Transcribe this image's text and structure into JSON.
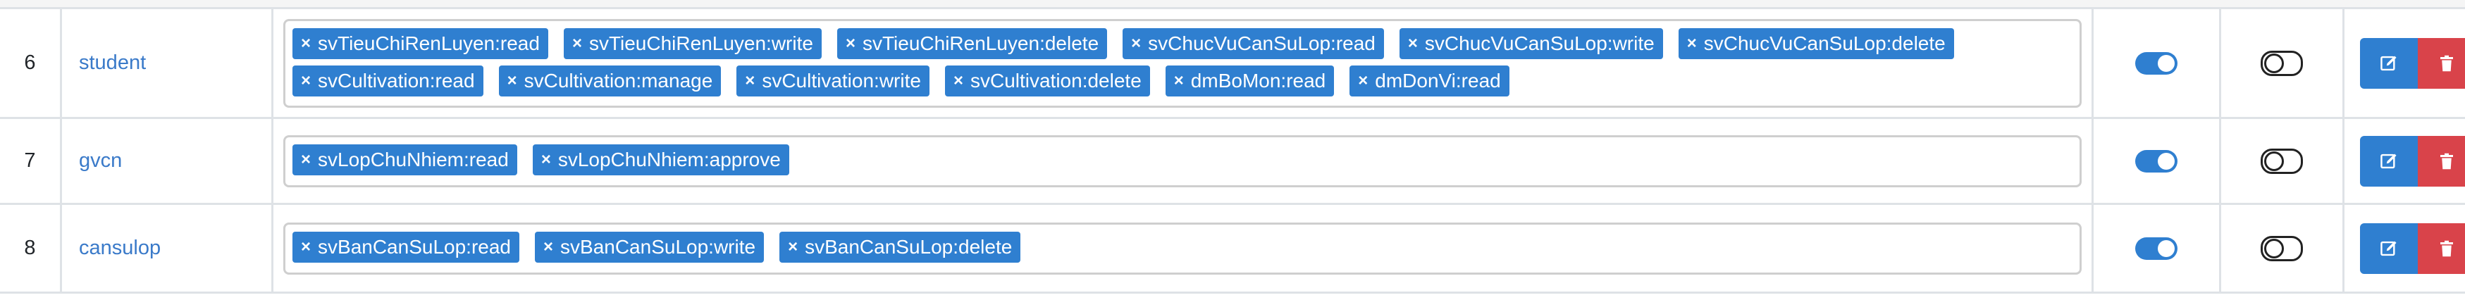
{
  "rows": [
    {
      "index": "6",
      "name": "student",
      "permissions": [
        "svTieuChiRenLuyen:read",
        "svTieuChiRenLuyen:write",
        "svTieuChiRenLuyen:delete",
        "svChucVuCanSuLop:read",
        "svChucVuCanSuLop:write",
        "svChucVuCanSuLop:delete",
        "svCultivation:read",
        "svCultivation:manage",
        "svCultivation:write",
        "svCultivation:delete",
        "dmBoMon:read",
        "dmDonVi:read"
      ],
      "toggle_1": "on",
      "toggle_2": "off"
    },
    {
      "index": "7",
      "name": "gvcn",
      "permissions": [
        "svLopChuNhiem:read",
        "svLopChuNhiem:approve"
      ],
      "toggle_1": "on",
      "toggle_2": "off"
    },
    {
      "index": "8",
      "name": "cansulop",
      "permissions": [
        "svBanCanSuLop:read",
        "svBanCanSuLop:write",
        "svBanCanSuLop:delete"
      ],
      "toggle_1": "on",
      "toggle_2": "off"
    }
  ],
  "tag_remove_glyph": "×",
  "icons": {
    "edit": "edit-icon",
    "delete": "trash-icon"
  },
  "colors": {
    "primary": "#2f7fd0",
    "danger": "#d9434a",
    "link": "#3a7ac9"
  }
}
